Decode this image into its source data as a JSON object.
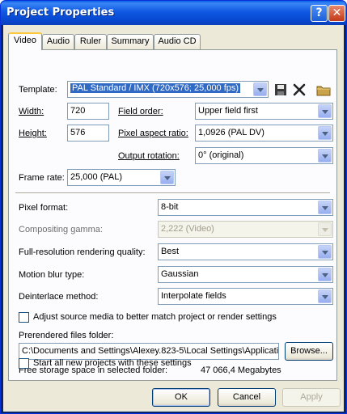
{
  "window": {
    "title": "Project Properties",
    "help_label": "?",
    "close_label": "✕"
  },
  "tabs": [
    {
      "label": "Video",
      "active": true
    },
    {
      "label": "Audio"
    },
    {
      "label": "Ruler"
    },
    {
      "label": "Summary"
    },
    {
      "label": "Audio CD"
    }
  ],
  "video": {
    "template_label": "Template:",
    "template_value": "PAL Standard / IMX (720x576; 25,000 fps)",
    "width_label": "Width:",
    "width_value": "720",
    "height_label": "Height:",
    "height_value": "576",
    "field_order_label": "Field order:",
    "field_order_value": "Upper field first",
    "pixel_aspect_label": "Pixel aspect ratio:",
    "pixel_aspect_value": "1,0926 (PAL DV)",
    "output_rotation_label": "Output rotation:",
    "output_rotation_value": "0° (original)",
    "frame_rate_label": "Frame rate:",
    "frame_rate_value": "25,000 (PAL)",
    "pixel_format_label": "Pixel format:",
    "pixel_format_value": "8-bit",
    "compositing_gamma_label": "Compositing gamma:",
    "compositing_gamma_value": "2,222 (Video)",
    "render_quality_label": "Full-resolution rendering quality:",
    "render_quality_value": "Best",
    "motion_blur_label": "Motion blur type:",
    "motion_blur_value": "Gaussian",
    "deinterlace_label": "Deinterlace method:",
    "deinterlace_value": "Interpolate fields",
    "adjust_source_label": "Adjust source media to better match project or render settings",
    "adjust_source_checked": false,
    "prerendered_label": "Prerendered files folder:",
    "prerendered_value": "C:\\Documents and Settings\\Alexey.823-5\\Local Settings\\Applicati",
    "browse_label": "Browse...",
    "free_space_label": "Free storage space in selected folder:",
    "free_space_value": "47 066,4 Megabytes",
    "start_all_label": "Start all new projects with these settings",
    "start_all_checked": false
  },
  "footer": {
    "ok_label": "OK",
    "cancel_label": "Cancel",
    "apply_label": "Apply"
  },
  "icons": [
    "save-icon",
    "delete-icon",
    "folder-icon",
    "chevron-down-icon"
  ],
  "colors": {
    "titlebar": "#0747cf",
    "dialog_face": "#ece9d8",
    "selection": "#316ac5",
    "tab_highlight": "#ffc83c"
  }
}
